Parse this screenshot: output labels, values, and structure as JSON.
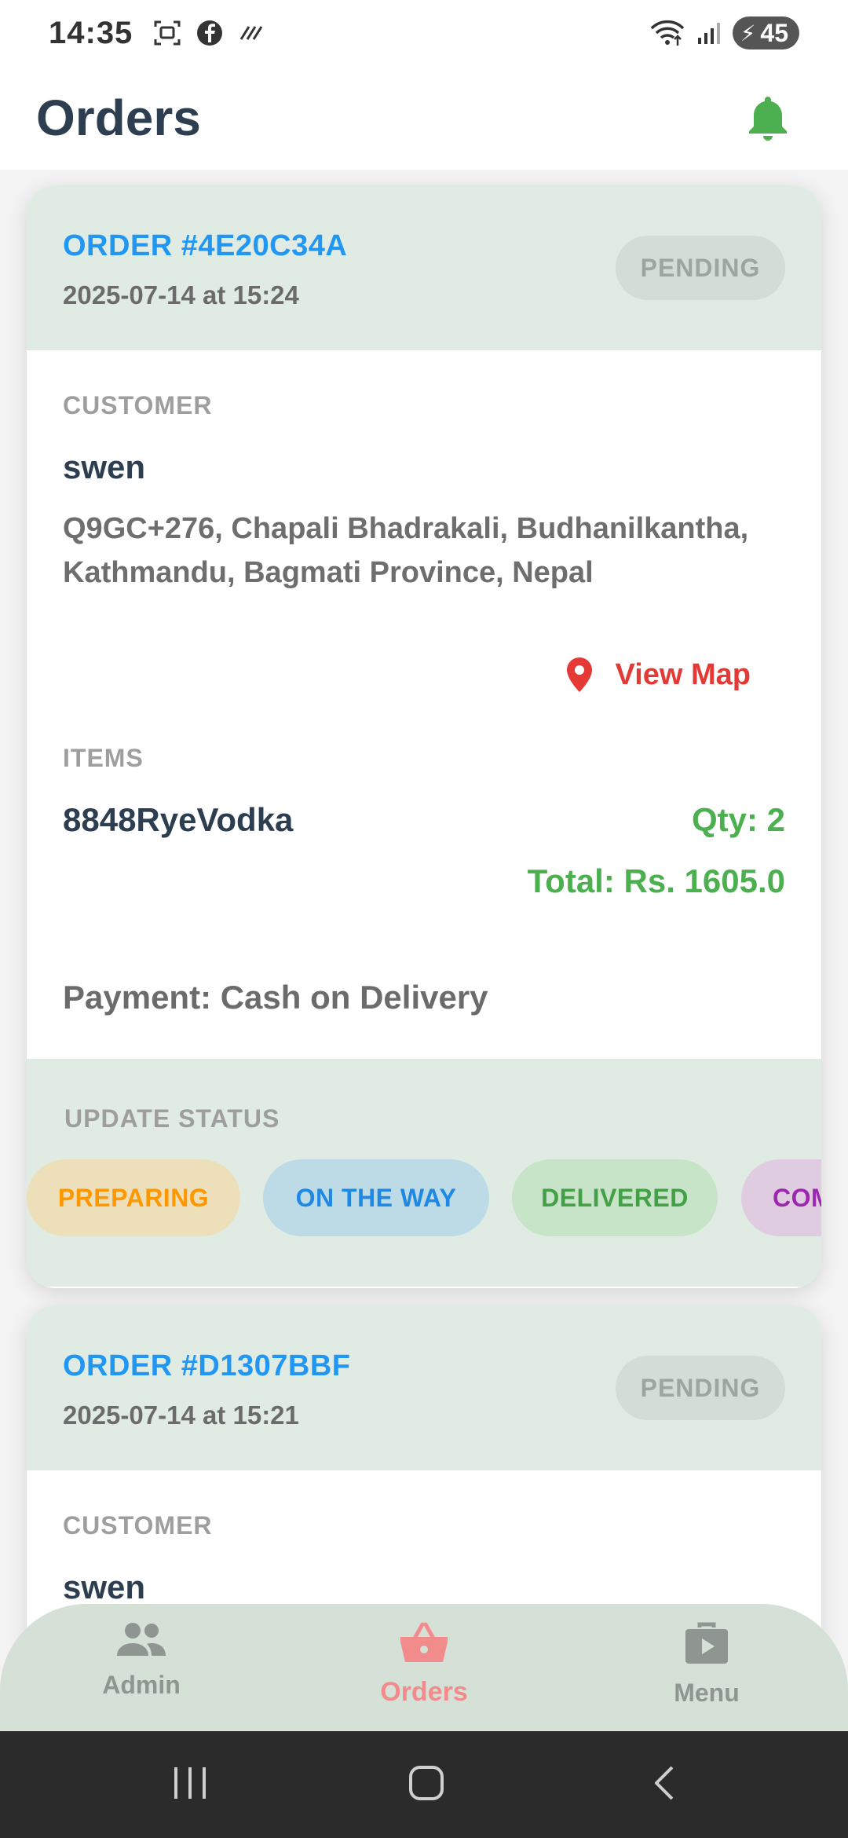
{
  "status_bar": {
    "time": "14:35",
    "battery_level": "45",
    "icons": [
      "screenshot-icon",
      "facebook-icon",
      "nfc-icon",
      "wifi-icon",
      "signal-icon",
      "battery-charging-icon"
    ]
  },
  "header": {
    "title": "Orders",
    "notification_icon": "bell-icon",
    "accent_color": "#4caf50"
  },
  "orders": [
    {
      "id": "ORDER #4E20C34A",
      "date": "2025-07-14 at 15:24",
      "status": "PENDING",
      "customer_label": "CUSTOMER",
      "customer_name": "swen",
      "address": "Q9GC+276, Chapali Bhadrakali, Budhanilkantha, Kathmandu, Bagmati Province, Nepal",
      "view_map_label": "View Map",
      "items_label": "ITEMS",
      "items": [
        {
          "name": "8848RyeVodka",
          "qty": "Qty: 2"
        }
      ],
      "total": "Total: Rs. 1605.0",
      "payment": "Payment: Cash on Delivery",
      "update_status_label": "UPDATE STATUS",
      "status_options": [
        "PREPARING",
        "ON THE WAY",
        "DELIVERED",
        "COMPLETED"
      ]
    },
    {
      "id": "ORDER #D1307BBF",
      "date": "2025-07-14 at 15:21",
      "status": "PENDING",
      "customer_label": "CUSTOMER",
      "customer_name": "swen"
    }
  ],
  "bottom_nav": {
    "items": [
      {
        "label": "Admin",
        "icon": "people-icon",
        "active": false
      },
      {
        "label": "Orders",
        "icon": "basket-icon",
        "active": true
      },
      {
        "label": "Menu",
        "icon": "menu-briefcase-icon",
        "active": false
      }
    ],
    "active_color": "#f28b8b",
    "inactive_color": "#8f9691"
  },
  "system_nav": {
    "buttons": [
      "recent-apps-icon",
      "home-icon",
      "back-icon"
    ]
  }
}
